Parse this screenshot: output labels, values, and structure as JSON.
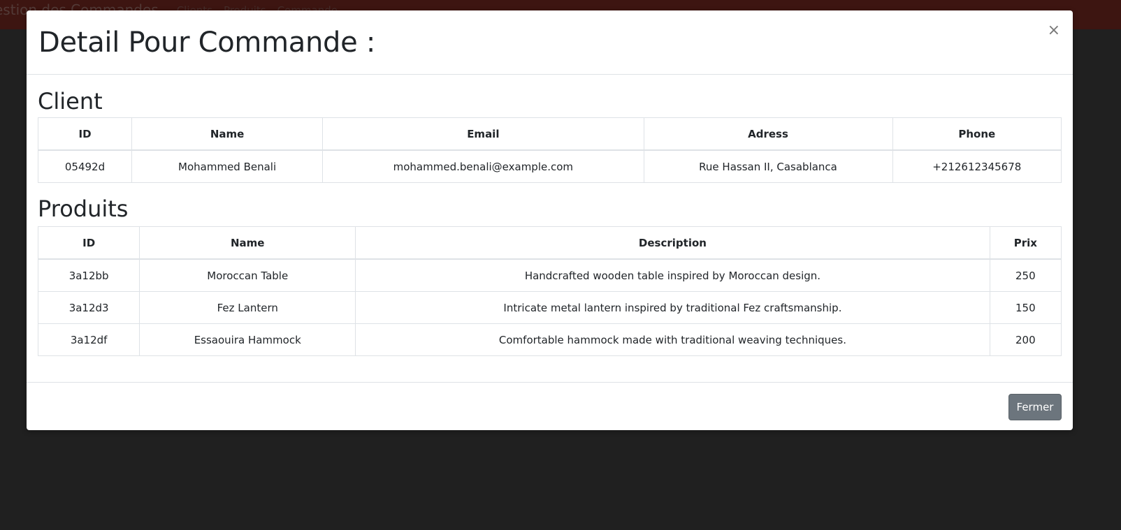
{
  "navbar": {
    "brand": "estion des Commandes",
    "links": [
      "Clients",
      "Produits",
      "Commande"
    ]
  },
  "modal": {
    "title": "Detail Pour Commande :",
    "close_symbol": "×",
    "client_section_title": "Client",
    "client_table": {
      "headers": [
        "ID",
        "Name",
        "Email",
        "Adress",
        "Phone"
      ],
      "rows": [
        [
          "05492d",
          "Mohammed Benali",
          "mohammed.benali@example.com",
          "Rue Hassan II, Casablanca",
          "+212612345678"
        ]
      ]
    },
    "products_section_title": "Produits",
    "products_table": {
      "headers": [
        "ID",
        "Name",
        "Description",
        "Prix"
      ],
      "rows": [
        [
          "3a12bb",
          "Moroccan Table",
          "Handcrafted wooden table inspired by Moroccan design.",
          "250"
        ],
        [
          "3a12d3",
          "Fez Lantern",
          "Intricate metal lantern inspired by traditional Fez craftsmanship.",
          "150"
        ],
        [
          "3a12df",
          "Essaouira Hammock",
          "Comfortable hammock made with traditional weaving techniques.",
          "200"
        ]
      ]
    },
    "footer_button": "Fermer"
  },
  "colors": {
    "navbar": "#7a2a22",
    "backdrop": "#404040",
    "button": "#6c757d"
  }
}
